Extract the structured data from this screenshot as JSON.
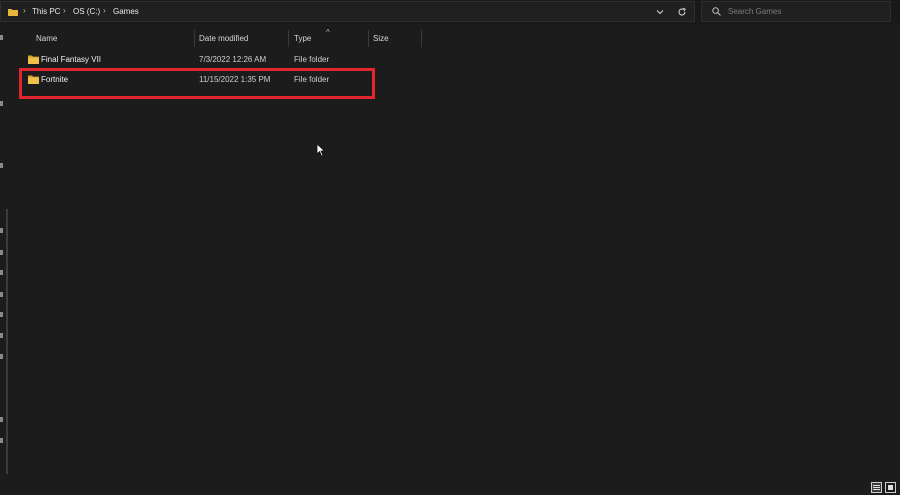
{
  "address_bar": {
    "breadcrumbs": [
      "This PC",
      "OS (C:)",
      "Games"
    ],
    "separator": "›"
  },
  "search": {
    "placeholder": "Search Games"
  },
  "columns": {
    "name": "Name",
    "date": "Date modified",
    "type": "Type",
    "size": "Size",
    "sort_indicator": "^"
  },
  "files": [
    {
      "name": "Final Fantasy VII",
      "date": "7/3/2022 12:26 AM",
      "type": "File folder",
      "icon": "folder-icon"
    },
    {
      "name": "Fortnite",
      "date": "11/15/2022 1:35 PM",
      "type": "File folder",
      "icon": "folder-icon"
    }
  ],
  "colors": {
    "background": "#1c1c1c",
    "highlight_box": "#e0272f",
    "folder": "#e8b53a"
  },
  "status_bar": {
    "views": [
      "details-view-icon",
      "large-icons-view-icon"
    ]
  }
}
